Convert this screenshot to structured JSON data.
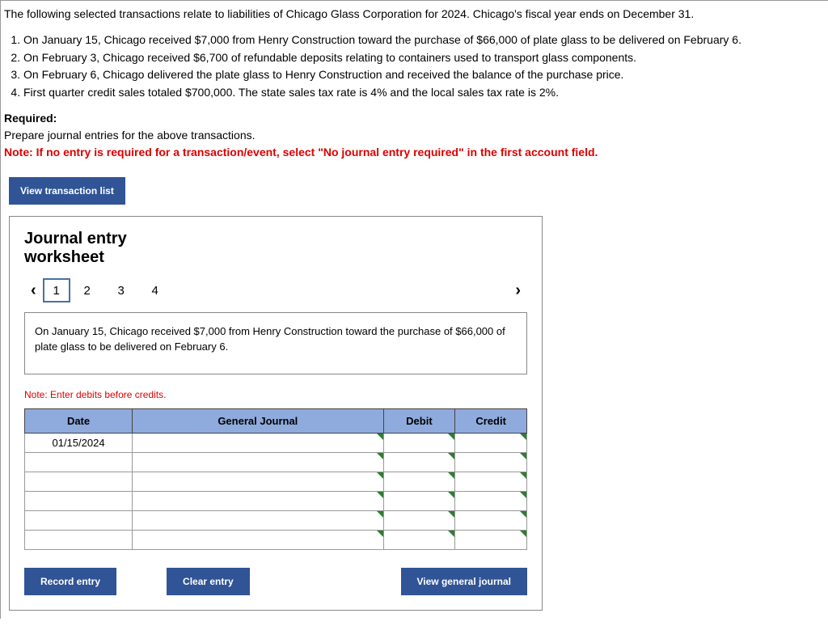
{
  "intro": "The following selected transactions relate to liabilities of Chicago Glass Corporation for 2024. Chicago's fiscal year ends on December 31.",
  "transactions": [
    "On January 15, Chicago received $7,000 from Henry Construction toward the purchase of $66,000 of plate glass to be delivered on February 6.",
    "On February 3, Chicago received $6,700 of refundable deposits relating to containers used to transport glass components.",
    "On February 6, Chicago delivered the plate glass to Henry Construction and received the balance of the purchase price.",
    "First quarter credit sales totaled $700,000. The state sales tax rate is 4% and the local sales tax rate is 2%."
  ],
  "required": {
    "label": "Required:",
    "text": "Prepare journal entries for the above transactions.",
    "note": "Note: If no entry is required for a transaction/event, select \"No journal entry required\" in the first account field."
  },
  "buttons": {
    "view_transaction_list": "View transaction list",
    "record_entry": "Record entry",
    "clear_entry": "Clear entry",
    "view_general_journal": "View general journal"
  },
  "worksheet": {
    "title_line1": "Journal entry",
    "title_line2": "worksheet",
    "pages": [
      "1",
      "2",
      "3",
      "4"
    ],
    "active_page": "1",
    "description": "On January 15, Chicago received $7,000 from Henry Construction toward the purchase of $66,000 of plate glass to be delivered on February 6.",
    "note_debits": "Note: Enter debits before credits.",
    "headers": {
      "date": "Date",
      "journal": "General Journal",
      "debit": "Debit",
      "credit": "Credit"
    },
    "rows": [
      {
        "date": "01/15/2024"
      },
      {
        "date": ""
      },
      {
        "date": ""
      },
      {
        "date": ""
      },
      {
        "date": ""
      },
      {
        "date": ""
      }
    ]
  }
}
